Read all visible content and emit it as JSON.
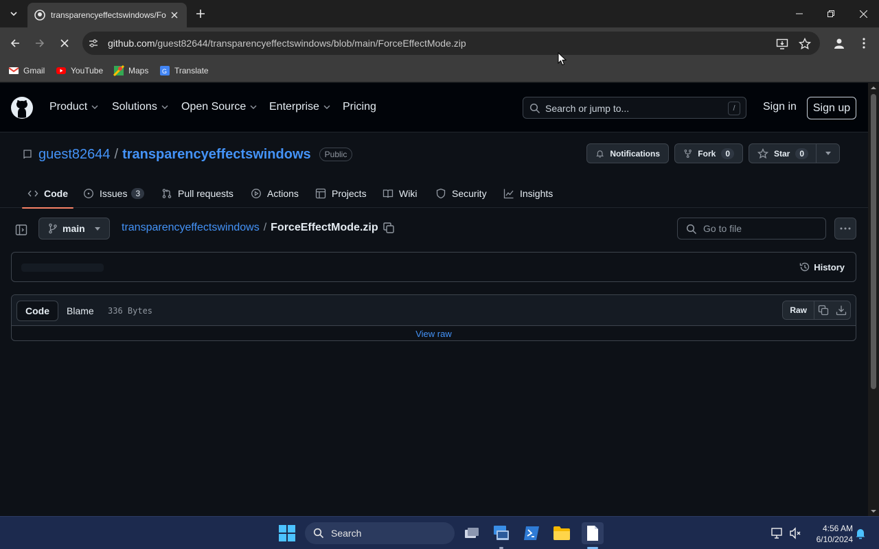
{
  "browser": {
    "tab_title": "transparencyeffectswindows/ForceEffectMode.zip",
    "url_host": "github.com",
    "url_path": "/guest82644/transparencyeffectswindows/blob/main/ForceEffectMode.zip",
    "bookmarks": [
      {
        "label": "Gmail",
        "icon": "gmail-icon"
      },
      {
        "label": "YouTube",
        "icon": "youtube-icon"
      },
      {
        "label": "Maps",
        "icon": "maps-icon"
      },
      {
        "label": "Translate",
        "icon": "translate-icon"
      }
    ]
  },
  "header": {
    "nav": [
      {
        "label": "Product",
        "dropdown": true
      },
      {
        "label": "Solutions",
        "dropdown": true
      },
      {
        "label": "Open Source",
        "dropdown": true
      },
      {
        "label": "Enterprise",
        "dropdown": true
      },
      {
        "label": "Pricing",
        "dropdown": false
      }
    ],
    "search_placeholder": "Search or jump to...",
    "search_shortcut": "/",
    "sign_in": "Sign in",
    "sign_up": "Sign up"
  },
  "repo": {
    "owner": "guest82644",
    "separator": "/",
    "name": "transparencyeffectswindows",
    "visibility": "Public",
    "notifications_label": "Notifications",
    "fork_label": "Fork",
    "fork_count": "0",
    "star_label": "Star",
    "star_count": "0",
    "tabs": [
      {
        "label": "Code",
        "icon": "code-icon",
        "active": true
      },
      {
        "label": "Issues",
        "icon": "issue-icon",
        "counter": "3"
      },
      {
        "label": "Pull requests",
        "icon": "pull-request-icon"
      },
      {
        "label": "Actions",
        "icon": "play-icon"
      },
      {
        "label": "Projects",
        "icon": "table-icon"
      },
      {
        "label": "Wiki",
        "icon": "book-icon"
      },
      {
        "label": "Security",
        "icon": "shield-icon"
      },
      {
        "label": "Insights",
        "icon": "graph-icon"
      }
    ]
  },
  "file": {
    "branch": "main",
    "breadcrumb_repo": "transparencyeffectswindows",
    "breadcrumb_sep": "/",
    "file_name": "ForceEffectMode.zip",
    "goto_placeholder": "Go to file",
    "history_label": "History",
    "view_code": "Code",
    "view_blame": "Blame",
    "size": "336 Bytes",
    "raw_label": "Raw",
    "view_raw": "View raw"
  },
  "taskbar": {
    "search_label": "Search",
    "time": "4:56 AM",
    "date": "6/10/2024"
  },
  "colors": {
    "accent_link": "#4493f8",
    "active_tab_underline": "#f78166",
    "page_bg": "#0d1117"
  }
}
